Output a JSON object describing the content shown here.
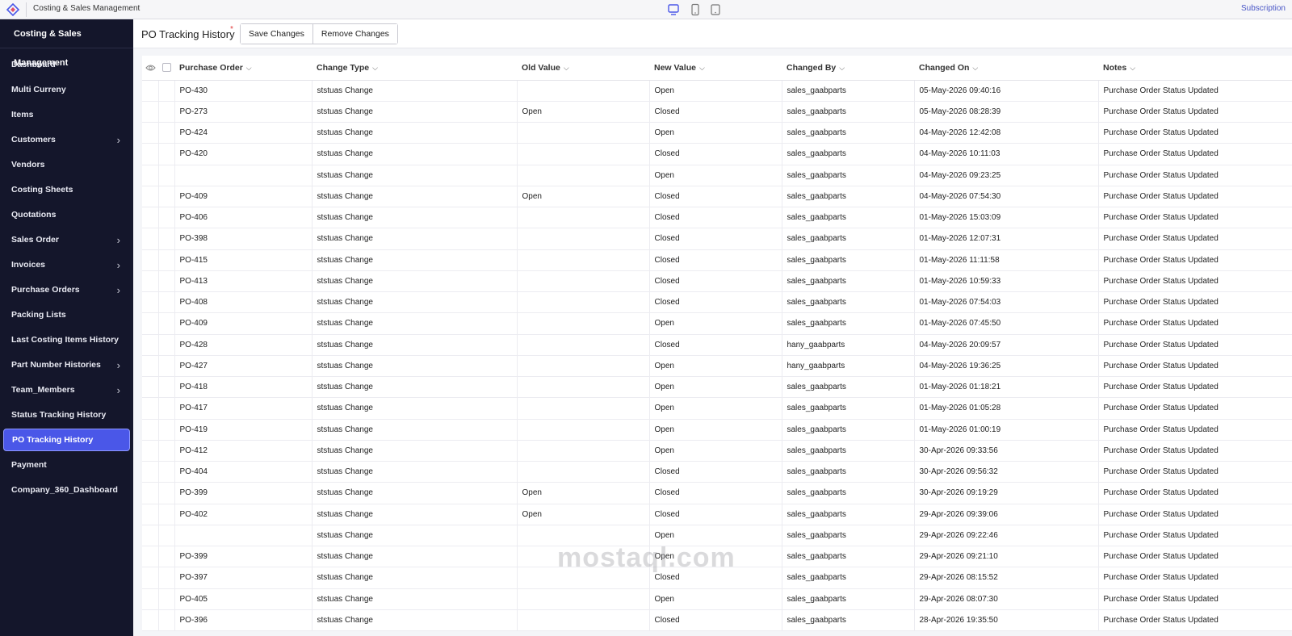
{
  "topbar": {
    "app_title": "Costing & Sales Management",
    "subscription": "Subscription"
  },
  "sidebar": {
    "brand": "Costing & Sales Management",
    "items": [
      {
        "label": "Dashboard",
        "has_children": false
      },
      {
        "label": "Multi Curreny",
        "has_children": false
      },
      {
        "label": "Items",
        "has_children": false
      },
      {
        "label": "Customers",
        "has_children": true
      },
      {
        "label": "Vendors",
        "has_children": false
      },
      {
        "label": "Costing Sheets",
        "has_children": false
      },
      {
        "label": "Quotations",
        "has_children": false
      },
      {
        "label": "Sales Order",
        "has_children": true
      },
      {
        "label": "Invoices",
        "has_children": true
      },
      {
        "label": "Purchase Orders",
        "has_children": true
      },
      {
        "label": "Packing Lists",
        "has_children": false
      },
      {
        "label": "Last Costing Items History",
        "has_children": false
      },
      {
        "label": "Part Number Histories",
        "has_children": true
      },
      {
        "label": "Team_Members",
        "has_children": true
      },
      {
        "label": "Status Tracking History",
        "has_children": false
      },
      {
        "label": "PO Tracking History",
        "has_children": false,
        "active": true
      },
      {
        "label": "Payment",
        "has_children": false
      },
      {
        "label": "Company_360_Dashboard",
        "has_children": false
      }
    ]
  },
  "header": {
    "title": "PO Tracking History",
    "required_mark": "*",
    "save_label": "Save Changes",
    "remove_label": "Remove Changes"
  },
  "table": {
    "columns": [
      "Purchase Order",
      "Change Type",
      "Old Value",
      "New Value",
      "Changed By",
      "Changed On",
      "Notes"
    ],
    "rows": [
      [
        "PO-430",
        "ststuas Change",
        "",
        "Open",
        "sales_gaabparts",
        "05-May-2026 09:40:16",
        "Purchase Order Status Updated"
      ],
      [
        "PO-273",
        "ststuas Change",
        "Open",
        "Closed",
        "sales_gaabparts",
        "05-May-2026 08:28:39",
        "Purchase Order Status Updated"
      ],
      [
        "PO-424",
        "ststuas Change",
        "",
        "Open",
        "sales_gaabparts",
        "04-May-2026 12:42:08",
        "Purchase Order Status Updated"
      ],
      [
        "PO-420",
        "ststuas Change",
        "",
        "Closed",
        "sales_gaabparts",
        "04-May-2026 10:11:03",
        "Purchase Order Status Updated"
      ],
      [
        "",
        "ststuas Change",
        "",
        "Open",
        "sales_gaabparts",
        "04-May-2026 09:23:25",
        "Purchase Order Status Updated"
      ],
      [
        "PO-409",
        "ststuas Change",
        "Open",
        "Closed",
        "sales_gaabparts",
        "04-May-2026 07:54:30",
        "Purchase Order Status Updated"
      ],
      [
        "PO-406",
        "ststuas Change",
        "",
        "Closed",
        "sales_gaabparts",
        "01-May-2026 15:03:09",
        "Purchase Order Status Updated"
      ],
      [
        "PO-398",
        "ststuas Change",
        "",
        "Closed",
        "sales_gaabparts",
        "01-May-2026 12:07:31",
        "Purchase Order Status Updated"
      ],
      [
        "PO-415",
        "ststuas Change",
        "",
        "Closed",
        "sales_gaabparts",
        "01-May-2026 11:11:58",
        "Purchase Order Status Updated"
      ],
      [
        "PO-413",
        "ststuas Change",
        "",
        "Closed",
        "sales_gaabparts",
        "01-May-2026 10:59:33",
        "Purchase Order Status Updated"
      ],
      [
        "PO-408",
        "ststuas Change",
        "",
        "Closed",
        "sales_gaabparts",
        "01-May-2026 07:54:03",
        "Purchase Order Status Updated"
      ],
      [
        "PO-409",
        "ststuas Change",
        "",
        "Open",
        "sales_gaabparts",
        "01-May-2026 07:45:50",
        "Purchase Order Status Updated"
      ],
      [
        "PO-428",
        "ststuas Change",
        "",
        "Closed",
        "hany_gaabparts",
        "04-May-2026 20:09:57",
        "Purchase Order Status Updated"
      ],
      [
        "PO-427",
        "ststuas Change",
        "",
        "Open",
        "hany_gaabparts",
        "04-May-2026 19:36:25",
        "Purchase Order Status Updated"
      ],
      [
        "PO-418",
        "ststuas Change",
        "",
        "Open",
        "sales_gaabparts",
        "01-May-2026 01:18:21",
        "Purchase Order Status Updated"
      ],
      [
        "PO-417",
        "ststuas Change",
        "",
        "Open",
        "sales_gaabparts",
        "01-May-2026 01:05:28",
        "Purchase Order Status Updated"
      ],
      [
        "PO-419",
        "ststuas Change",
        "",
        "Open",
        "sales_gaabparts",
        "01-May-2026 01:00:19",
        "Purchase Order Status Updated"
      ],
      [
        "PO-412",
        "ststuas Change",
        "",
        "Open",
        "sales_gaabparts",
        "30-Apr-2026 09:33:56",
        "Purchase Order Status Updated"
      ],
      [
        "PO-404",
        "ststuas Change",
        "",
        "Closed",
        "sales_gaabparts",
        "30-Apr-2026 09:56:32",
        "Purchase Order Status Updated"
      ],
      [
        "PO-399",
        "ststuas Change",
        "Open",
        "Closed",
        "sales_gaabparts",
        "30-Apr-2026 09:19:29",
        "Purchase Order Status Updated"
      ],
      [
        "PO-402",
        "ststuas Change",
        "Open",
        "Closed",
        "sales_gaabparts",
        "29-Apr-2026 09:39:06",
        "Purchase Order Status Updated"
      ],
      [
        "",
        "ststuas Change",
        "",
        "Open",
        "sales_gaabparts",
        "29-Apr-2026 09:22:46",
        "Purchase Order Status Updated"
      ],
      [
        "PO-399",
        "ststuas Change",
        "",
        "Open",
        "sales_gaabparts",
        "29-Apr-2026 09:21:10",
        "Purchase Order Status Updated"
      ],
      [
        "PO-397",
        "ststuas Change",
        "",
        "Closed",
        "sales_gaabparts",
        "29-Apr-2026 08:15:52",
        "Purchase Order Status Updated"
      ],
      [
        "PO-405",
        "ststuas Change",
        "",
        "Open",
        "sales_gaabparts",
        "29-Apr-2026 08:07:30",
        "Purchase Order Status Updated"
      ],
      [
        "PO-396",
        "ststuas Change",
        "",
        "Closed",
        "sales_gaabparts",
        "28-Apr-2026 19:35:50",
        "Purchase Order Status Updated"
      ]
    ]
  },
  "watermark": "mostaql.com",
  "colors": {
    "sidebar_bg": "#14162b",
    "active_item": "#4a57e8",
    "subscription_link": "#4a57c7",
    "required": "#e23b3b"
  }
}
